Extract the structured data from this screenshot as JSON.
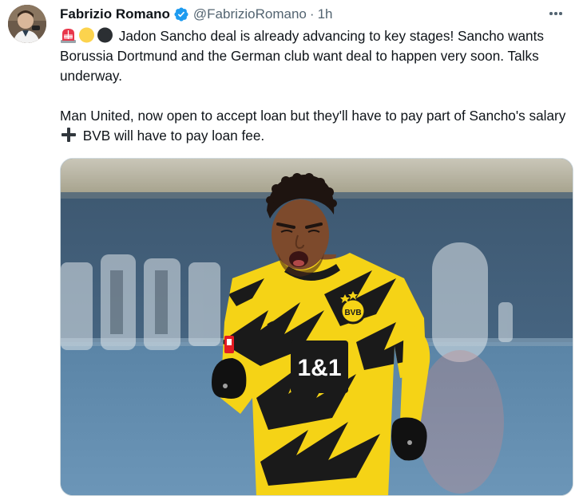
{
  "author": {
    "display_name": "Fabrizio Romano",
    "handle": "@FabrizioRomano",
    "separator": "·",
    "time": "1h",
    "verified": true
  },
  "tweet": {
    "line_1_icons": [
      "rotating-light-emoji",
      "yellow-circle-emoji",
      "black-circle-emoji"
    ],
    "para_1": "Jadon Sancho deal is already advancing to key stages! Sancho wants Borussia Dortmund and the German club want deal to happen very soon. Talks underway.",
    "para_2_part_1": "Man United, now open to accept loan but they'll have to pay part of Sancho's salary",
    "para_2_icon": "heavy-plus-emoji",
    "para_2_part_2": "BVB will have to pay loan fee."
  },
  "media": {
    "shirt_sponsor": "1&1",
    "crest_text": "BVB",
    "colors": {
      "shirt_yellow": "#f5d316",
      "stripe_black": "#1a1a1a",
      "stadium_blue": "#4a6a86"
    }
  },
  "colors": {
    "text_primary": "#0f1419",
    "text_secondary": "#536471",
    "verified_blue": "#1d9bf0"
  }
}
